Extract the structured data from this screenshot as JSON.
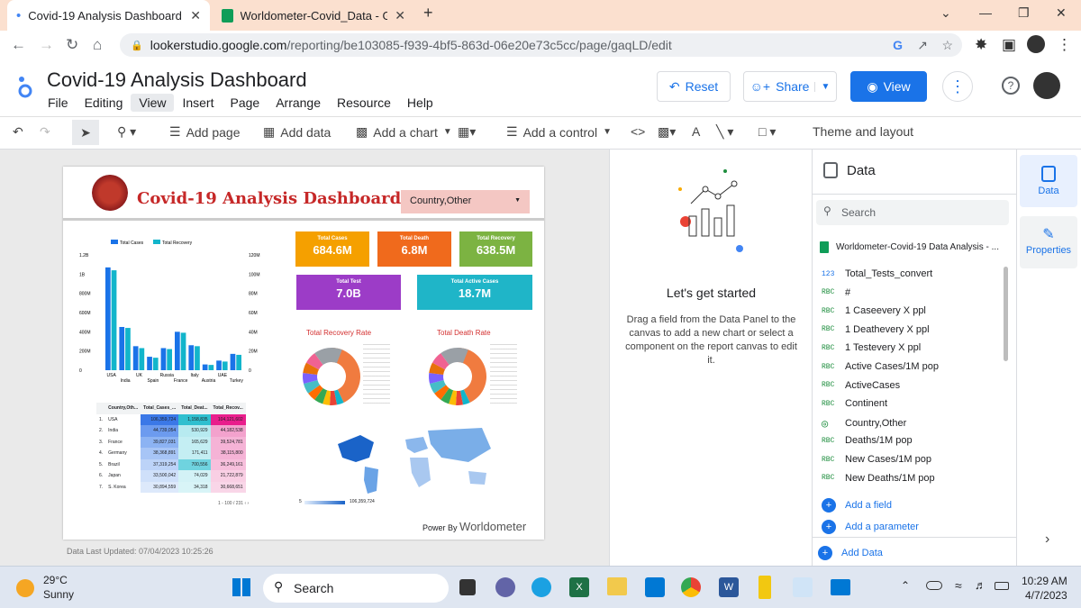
{
  "browser": {
    "tabs": [
      {
        "title": "Covid-19 Analysis Dashboard"
      },
      {
        "title": "Worldometer-Covid_Data - Goog"
      }
    ],
    "url_host": "lookerstudio.google.com",
    "url_path": "/reporting/be103085-f939-4bf5-863d-06e20e73c5cc/page/gaqLD/edit"
  },
  "app": {
    "title": "Covid-19 Analysis Dashboard",
    "menu": [
      "File",
      "Editing",
      "View",
      "Insert",
      "Page",
      "Arrange",
      "Resource",
      "Help"
    ],
    "reset": "Reset",
    "share": "Share",
    "view": "View"
  },
  "toolbar": {
    "add_page": "Add page",
    "add_data": "Add data",
    "add_chart": "Add a chart",
    "add_control": "Add a control",
    "theme": "Theme and layout"
  },
  "report": {
    "title": "Covid-19 Analysis Dashboard",
    "country_control": "Country,Other",
    "kpis": [
      {
        "label": "Total Cases",
        "value": "684.6M",
        "color": "#f5a000"
      },
      {
        "label": "Total Death",
        "value": "6.8M",
        "color": "#f06a1c"
      },
      {
        "label": "Total Recovery",
        "value": "638.5M",
        "color": "#7cb342"
      },
      {
        "label": "Total Test",
        "value": "7.0B",
        "color": "#9c3cc7"
      },
      {
        "label": "Total Active Cases",
        "value": "18.7M",
        "color": "#1fb5c8"
      }
    ],
    "recovery_title": "Total Recovery Rate",
    "death_title": "Total Death Rate",
    "table": {
      "headers": [
        "Country,Oth...",
        "Total_Cases_...",
        "Total_Deat...",
        "Total_Recov..."
      ],
      "rows": [
        [
          "1.",
          "USA",
          "106,359,724",
          "1,158,835",
          "104,121,602"
        ],
        [
          "2.",
          "India",
          "44,739,054",
          "530,929",
          "44,182,538"
        ],
        [
          "3.",
          "France",
          "39,827,031",
          "165,629",
          "39,524,781"
        ],
        [
          "4.",
          "Germany",
          "38,368,891",
          "171,411",
          "38,115,800"
        ],
        [
          "5.",
          "Brazil",
          "37,319,254",
          "700,556",
          "36,249,161"
        ],
        [
          "6.",
          "Japan",
          "33,500,042",
          "74,029",
          "21,722,879"
        ],
        [
          "7.",
          "S. Korea",
          "30,894,559",
          "34,318",
          "30,668,651"
        ]
      ],
      "pager": "1 - 100 / 231"
    },
    "map_min": "5",
    "map_max": "106,359,724",
    "power_by": "Power By",
    "brand": "Worldometer",
    "updated": "Data Last Updated: 07/04/2023 10:25:26"
  },
  "chart_data": {
    "type": "bar",
    "categories": [
      "USA",
      "India",
      "UK",
      "Spain",
      "Russia",
      "France",
      "Italy",
      "Austria",
      "UAE",
      "Turkey"
    ],
    "series": [
      {
        "name": "Total Cases",
        "values": [
          1070000000,
          450000000,
          250000000,
          140000000,
          230000000,
          400000000,
          260000000,
          60000000,
          100000000,
          170000000
        ]
      },
      {
        "name": "Total Recovery",
        "values": [
          1040000000,
          440000000,
          230000000,
          130000000,
          220000000,
          390000000,
          250000000,
          55000000,
          90000000,
          160000000
        ]
      }
    ],
    "y_left_ticks": [
      "0",
      "200M",
      "400M",
      "600M",
      "800M",
      "1B",
      "1.2B"
    ],
    "y_right_ticks": [
      "0",
      "20M",
      "40M",
      "60M",
      "80M",
      "100M",
      "120M"
    ],
    "legend": "top-left",
    "colors": [
      "#1a73e8",
      "#12b5cb"
    ]
  },
  "middle": {
    "heading": "Let's get started",
    "body": "Drag a field from the Data Panel to the canvas to add a new chart or select a component on the report canvas to edit it."
  },
  "data_panel": {
    "title": "Data",
    "search": "Search",
    "source": "Worldometer-Covid-19 Data Analysis - ...",
    "fields": [
      {
        "type": "123",
        "name": "Total_Tests_convert"
      },
      {
        "type": "RBC",
        "name": "#"
      },
      {
        "type": "RBC",
        "name": "1 Caseevery X ppl"
      },
      {
        "type": "RBC",
        "name": "1 Deathevery X ppl"
      },
      {
        "type": "RBC",
        "name": "1 Testevery X ppl"
      },
      {
        "type": "RBC",
        "name": "Active Cases/1M pop"
      },
      {
        "type": "RBC",
        "name": "ActiveCases"
      },
      {
        "type": "RBC",
        "name": "Continent"
      },
      {
        "type": "globe",
        "name": "Country,Other"
      },
      {
        "type": "RBC",
        "name": "Deaths/1M pop"
      },
      {
        "type": "RBC",
        "name": "New Cases/1M pop"
      },
      {
        "type": "RBC",
        "name": "New Deaths/1M pop"
      }
    ],
    "add_field": "Add a field",
    "add_param": "Add a parameter",
    "add_data": "Add Data"
  },
  "rail": {
    "data": "Data",
    "properties": "Properties"
  },
  "taskbar": {
    "temp": "29°C",
    "weather": "Sunny",
    "search": "Search",
    "time": "10:29 AM",
    "date": "4/7/2023"
  }
}
